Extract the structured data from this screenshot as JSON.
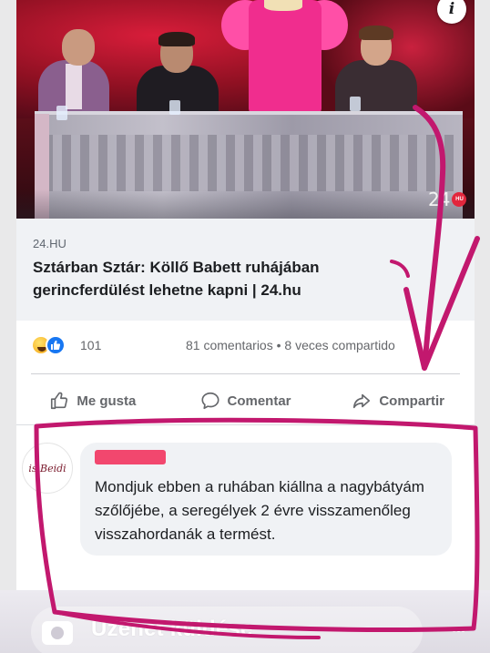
{
  "colors": {
    "accent_like": "#1877f2",
    "annotation": "#c2186e",
    "text_primary": "#1c1e21",
    "text_secondary": "#65676b"
  },
  "post": {
    "thumbnail": {
      "info_icon": "i",
      "channel_logo": "24",
      "channel_logo_badge": "HU"
    },
    "link": {
      "source": "24.HU",
      "headline": "Sztárban Sztár: Köllő Babett ruhájában gerincferdülést lehetne kapni | 24.hu"
    },
    "reactions": {
      "icons": [
        "haha-icon",
        "like-icon"
      ],
      "count": "101",
      "meta": "81 comentarios • 8 veces compartido"
    },
    "actions": {
      "like": "Me gusta",
      "comment": "Comentar",
      "share": "Compartir"
    }
  },
  "comment": {
    "avatar_text": "is Beidi",
    "text": "Mondjuk ebben a ruhában kiállna a nagybátyám szőlőjébe, a seregélyek 2 évre visszamenőleg visszahordanák a termést."
  },
  "message_bar": {
    "placeholder": "Üzenet küldése",
    "more": "..."
  }
}
